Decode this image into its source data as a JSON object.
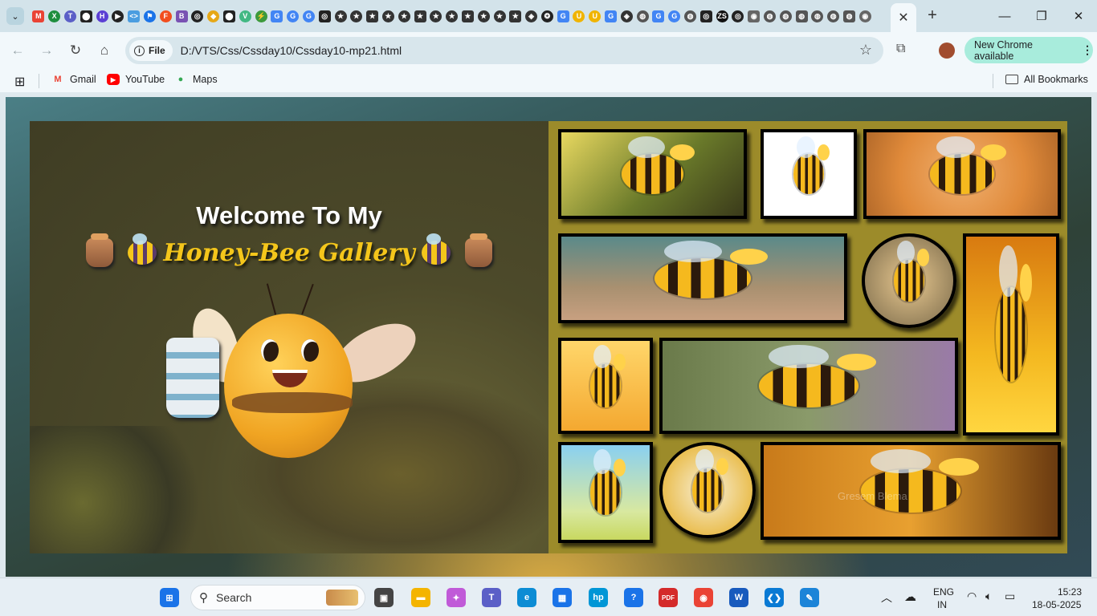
{
  "browser": {
    "active_tab_close": "✕",
    "new_tab": "+",
    "window": {
      "minimize": "—",
      "maximize": "❐",
      "close": "✕"
    },
    "pinned_favicons": [
      {
        "name": "gmail",
        "bg": "#ea4335",
        "t": "M"
      },
      {
        "name": "sheets",
        "bg": "#1e8e3e",
        "t": "X"
      },
      {
        "name": "teams",
        "bg": "#5b5fc7",
        "t": "T"
      },
      {
        "name": "github",
        "bg": "#222",
        "t": "⬤"
      },
      {
        "name": "app",
        "bg": "#5b3fd4",
        "t": "H"
      },
      {
        "name": "play",
        "bg": "#222",
        "t": "▶"
      },
      {
        "name": "code",
        "bg": "#4b9de0",
        "t": "<>"
      },
      {
        "name": "flag",
        "bg": "#1a73e8",
        "t": "⚑"
      },
      {
        "name": "figma",
        "bg": "#f24e1e",
        "t": "F"
      },
      {
        "name": "bootstrap",
        "bg": "#7952b3",
        "t": "B"
      },
      {
        "name": "chatgpt",
        "bg": "#222",
        "t": "◎"
      },
      {
        "name": "course",
        "bg": "#e6a817",
        "t": "◆"
      },
      {
        "name": "github",
        "bg": "#222",
        "t": "⬤"
      },
      {
        "name": "vue",
        "bg": "#41b883",
        "t": "V"
      },
      {
        "name": "ext",
        "bg": "#3c9a3c",
        "t": "⚡"
      },
      {
        "name": "google",
        "bg": "#4285f4",
        "t": "G"
      },
      {
        "name": "google",
        "bg": "#4285f4",
        "t": "G"
      },
      {
        "name": "google",
        "bg": "#4285f4",
        "t": "G"
      },
      {
        "name": "chatgpt",
        "bg": "#222",
        "t": "◎"
      },
      {
        "name": "star",
        "bg": "#333",
        "t": "★"
      },
      {
        "name": "star",
        "bg": "#333",
        "t": "★"
      },
      {
        "name": "star",
        "bg": "#333",
        "t": "★"
      },
      {
        "name": "star",
        "bg": "#333",
        "t": "★"
      },
      {
        "name": "star",
        "bg": "#333",
        "t": "★"
      },
      {
        "name": "star",
        "bg": "#333",
        "t": "★"
      },
      {
        "name": "star",
        "bg": "#333",
        "t": "★"
      },
      {
        "name": "star",
        "bg": "#333",
        "t": "★"
      },
      {
        "name": "star",
        "bg": "#333",
        "t": "★"
      },
      {
        "name": "star",
        "bg": "#333",
        "t": "★"
      },
      {
        "name": "star",
        "bg": "#333",
        "t": "★"
      },
      {
        "name": "star",
        "bg": "#333",
        "t": "★"
      },
      {
        "name": "codepen",
        "bg": "#333",
        "t": "◈"
      },
      {
        "name": "openai",
        "bg": "#222",
        "t": "❂"
      },
      {
        "name": "google",
        "bg": "#4285f4",
        "t": "G"
      },
      {
        "name": "cup",
        "bg": "#f0b400",
        "t": "U"
      },
      {
        "name": "cup",
        "bg": "#f0b400",
        "t": "U"
      },
      {
        "name": "google",
        "bg": "#4285f4",
        "t": "G"
      },
      {
        "name": "codepen",
        "bg": "#333",
        "t": "◈"
      },
      {
        "name": "globe",
        "bg": "#555",
        "t": "◍"
      },
      {
        "name": "google",
        "bg": "#4285f4",
        "t": "G"
      },
      {
        "name": "google",
        "bg": "#4285f4",
        "t": "G"
      },
      {
        "name": "globe",
        "bg": "#555",
        "t": "◍"
      },
      {
        "name": "chatgpt",
        "bg": "#222",
        "t": "◎"
      },
      {
        "name": "zs",
        "bg": "#111",
        "t": "ZS"
      },
      {
        "name": "chatgpt",
        "bg": "#222",
        "t": "◎"
      },
      {
        "name": "chrome",
        "bg": "#666",
        "t": "◉"
      },
      {
        "name": "globe",
        "bg": "#555",
        "t": "◍"
      },
      {
        "name": "globe",
        "bg": "#555",
        "t": "◍"
      },
      {
        "name": "globe",
        "bg": "#555",
        "t": "◍"
      },
      {
        "name": "globe",
        "bg": "#555",
        "t": "◍"
      },
      {
        "name": "globe",
        "bg": "#555",
        "t": "◍"
      },
      {
        "name": "globe",
        "bg": "#555",
        "t": "◍"
      },
      {
        "name": "chrome",
        "bg": "#666",
        "t": "◉"
      }
    ]
  },
  "toolbar": {
    "back": "←",
    "forward": "→",
    "reload": "↻",
    "home": "⌂",
    "site_chip": "File",
    "url": "D:/VTS/Css/Cssday10/Cssday10-mp21.html",
    "bookmark_star": "☆",
    "extensions": "⧉",
    "new_chrome": "New Chrome available",
    "menu": "⋮"
  },
  "bookmarks": {
    "apps_icon": "⊞",
    "items": [
      {
        "label": "Gmail",
        "icon": "M",
        "color": "#ea4335"
      },
      {
        "label": "YouTube",
        "icon": "▶",
        "color": "#ff0000"
      },
      {
        "label": "Maps",
        "icon": "●",
        "color": "#34a853"
      }
    ],
    "all_bookmarks": "All Bookmarks"
  },
  "page": {
    "welcome": "Welcome To My",
    "gallery_title": "Honey-Bee Gallery",
    "colors": {
      "title_gold": "#f4c61b",
      "panel_gold": "#9c8b2a"
    },
    "gallery_images": [
      {
        "name": "bee-flying-forest",
        "bg": "linear-gradient(135deg,#e8d860,#6a7a2a 55%,#3a3a1a)"
      },
      {
        "name": "bee-standing-white",
        "bg": "#ffffff"
      },
      {
        "name": "bee-honey-splash",
        "bg": "radial-gradient(circle,#f0b070,#e08a3a 60%,#b46a2a)"
      },
      {
        "name": "bee-close-up-path",
        "bg": "linear-gradient(180deg,#5a8a8a,#a89070 60%,#c8a080)"
      },
      {
        "name": "bee-round-portrait",
        "bg": "radial-gradient(circle,#e8c890,#7a6a4a)"
      },
      {
        "name": "bee-on-sunflower",
        "bg": "linear-gradient(180deg,#d87a10,#f4b820 60%,#ffd640)"
      },
      {
        "name": "bee-happy-yellow",
        "bg": "linear-gradient(180deg,#ffd66a,#f4a830)"
      },
      {
        "name": "bee-garden-flowers",
        "bg": "linear-gradient(90deg,#6a7a4a,#8a9a6a 50%,#9a7aa8)"
      },
      {
        "name": "bee-spring-meadow",
        "bg": "linear-gradient(180deg,#8ad0f0,#d8e8a0 70%,#c8d860)"
      },
      {
        "name": "bee-round-flowers",
        "bg": "radial-gradient(circle,#f8f0d8,#e8b840 80%)"
      },
      {
        "name": "bee-macro-orange",
        "bg": "linear-gradient(90deg,#c87a1a,#e8a030 50%,#6a3a10)"
      }
    ],
    "watermark": "Gresem Blema"
  },
  "taskbar": {
    "search_placeholder": "Search",
    "lang": "ENG",
    "region": "IN",
    "time": "15:23",
    "date": "18-05-2025",
    "apps": [
      {
        "name": "start-icon",
        "bg": "#1a73e8",
        "t": "⊞"
      },
      {
        "name": "task-view-icon",
        "bg": "#444",
        "t": "▣"
      },
      {
        "name": "file-explorer-icon",
        "bg": "#f4b400",
        "t": "▬"
      },
      {
        "name": "copilot-icon",
        "bg": "#c05ad8",
        "t": "✦"
      },
      {
        "name": "teams-icon",
        "bg": "#5b5fc7",
        "t": "T"
      },
      {
        "name": "edge-icon",
        "bg": "#0c8cd4",
        "t": "e"
      },
      {
        "name": "store-icon",
        "bg": "#1a73e8",
        "t": "▦"
      },
      {
        "name": "hp-icon",
        "bg": "#0096d6",
        "t": "hp"
      },
      {
        "name": "help-icon",
        "bg": "#1a73e8",
        "t": "?"
      },
      {
        "name": "pdf-icon",
        "bg": "#d42a2a",
        "t": "PDF"
      },
      {
        "name": "chrome-icon",
        "bg": "#ea4335",
        "t": "◉"
      },
      {
        "name": "word-icon",
        "bg": "#185abd",
        "t": "W"
      },
      {
        "name": "vscode-icon",
        "bg": "#0a7ad4",
        "t": "❮❯"
      },
      {
        "name": "paint-icon",
        "bg": "#1c84d8",
        "t": "✎"
      }
    ]
  }
}
